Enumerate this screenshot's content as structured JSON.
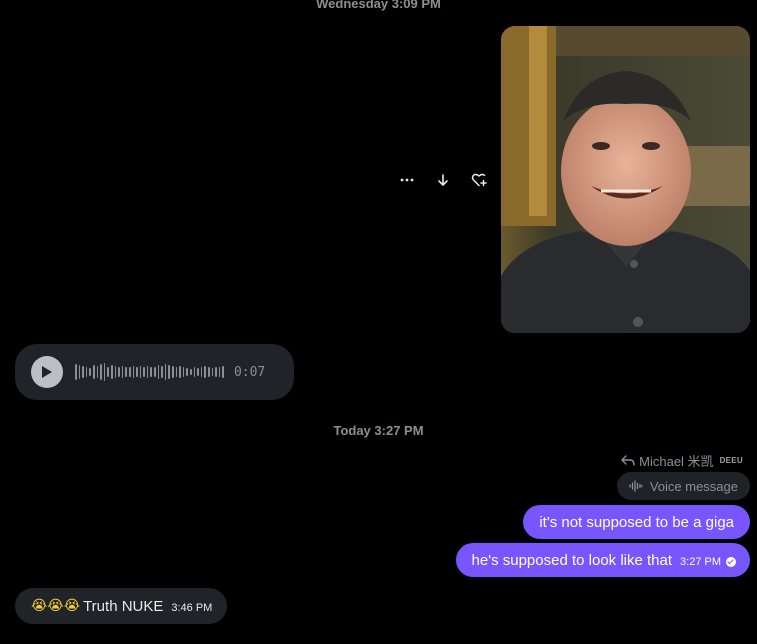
{
  "timestamps": {
    "top": "Wednesday 3:09 PM",
    "mid": "Today 3:27 PM"
  },
  "image_message": {
    "actions": [
      "more-icon",
      "download-icon",
      "react-icon"
    ]
  },
  "voice_message": {
    "duration": "0:07",
    "waveform": [
      16,
      14,
      12,
      10,
      8,
      14,
      12,
      16,
      18,
      10,
      14,
      12,
      10,
      12,
      10,
      10,
      12,
      10,
      12,
      10,
      12,
      10,
      10,
      14,
      12,
      16,
      14,
      12,
      10,
      12,
      10,
      8,
      6,
      10,
      8,
      10,
      12,
      10,
      8,
      10,
      10,
      12
    ]
  },
  "reply": {
    "author": "Michael 米凯",
    "tag": "DEEU",
    "quoted": "Voice message"
  },
  "sent_messages": [
    {
      "text": "it's not supposed to be a giga"
    },
    {
      "text": "he's supposed to look like that",
      "time": "3:27 PM"
    }
  ],
  "received_message": {
    "emoji": "😭😭😭",
    "text": "Truth NUKE",
    "time": "3:46 PM"
  },
  "colors": {
    "accent": "#7856ff",
    "bubble_dark": "#202327",
    "muted": "#8b8f94"
  }
}
